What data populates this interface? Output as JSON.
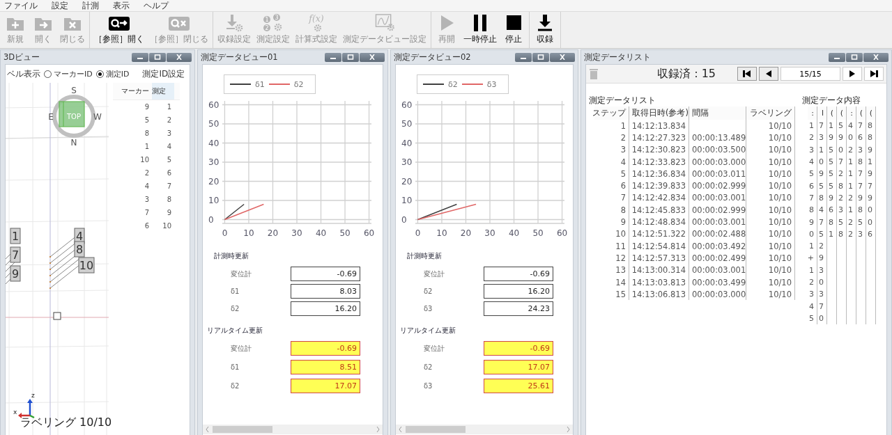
{
  "menu": [
    "ファイル",
    "設定",
    "計測",
    "表示",
    "ヘルプ"
  ],
  "toolbar": {
    "groups": [
      [
        {
          "kind": "new",
          "label": "新規",
          "disabled": true
        },
        {
          "kind": "open",
          "label": "開く",
          "disabled": true
        },
        {
          "kind": "close",
          "label": "閉じる",
          "disabled": true
        }
      ],
      [
        {
          "kind": "ref-open",
          "label": "［参照］開く",
          "disabled": false
        },
        {
          "kind": "ref-close",
          "label": "［参照］閉じる",
          "disabled": true
        }
      ],
      [
        {
          "kind": "record-settings",
          "label": "収録設定",
          "disabled": true
        },
        {
          "kind": "measure-settings",
          "label": "測定設定",
          "disabled": true,
          "glyphs": [
            "1",
            "3",
            "2"
          ]
        },
        {
          "kind": "formula",
          "label": "計算式設定",
          "disabled": true,
          "glyphs": [
            "f(x)"
          ]
        },
        {
          "kind": "view-settings",
          "label": "測定データビュー設定",
          "disabled": true
        }
      ],
      [
        {
          "kind": "resume",
          "label": "再開",
          "disabled": true
        },
        {
          "kind": "pause",
          "label": "一時停止",
          "disabled": false
        },
        {
          "kind": "stop",
          "label": "停止",
          "disabled": false
        }
      ],
      [
        {
          "kind": "record",
          "label": "収録",
          "disabled": false
        }
      ]
    ]
  },
  "view3d": {
    "title": "3Dビュー",
    "label_mode": {
      "label": "ベル表示",
      "options": [
        {
          "label": "マーカーID",
          "selected": false
        },
        {
          "label": "測定ID",
          "selected": true
        }
      ]
    },
    "compass": {
      "top": "S",
      "left": "E",
      "right": "W",
      "bottom": "N",
      "face": "TOP"
    },
    "markers": [
      "1",
      "7",
      "9",
      "4",
      "8",
      "10"
    ],
    "axes": {
      "z": "z",
      "x": "x"
    },
    "status": "ラベリング 10/10",
    "id_table": {
      "title": "測定ID設定",
      "columns": [
        "マーカー",
        "測定"
      ],
      "rows": [
        [
          "9",
          "1"
        ],
        [
          "5",
          "2"
        ],
        [
          "8",
          "3"
        ],
        [
          "1",
          "4"
        ],
        [
          "10",
          "5"
        ],
        [
          "2",
          "6"
        ],
        [
          "4",
          "7"
        ],
        [
          "3",
          "8"
        ],
        [
          "7",
          "9"
        ],
        [
          "6",
          "10"
        ]
      ]
    }
  },
  "views": [
    {
      "title": "測定データビュー01",
      "chart_data": {
        "type": "line",
        "grid": true,
        "xlim": [
          -1,
          61
        ],
        "ylim": [
          -2,
          62
        ],
        "xticks": [
          0,
          10,
          20,
          30,
          40,
          50,
          60
        ],
        "yticks": [
          0,
          10,
          20,
          30,
          40,
          50,
          60
        ],
        "series": [
          {
            "name": "δ1",
            "color": "#404040",
            "x": [
              0,
              8.03
            ],
            "values": [
              0,
              8
            ]
          },
          {
            "name": "δ2",
            "color": "#e06666",
            "x": [
              0,
              16.2
            ],
            "values": [
              0,
              8
            ]
          }
        ]
      },
      "measured": {
        "title": "計測時更新",
        "rows": [
          {
            "label": "変位計",
            "value": "-0.69"
          },
          {
            "label": "δ1",
            "value": "8.03"
          },
          {
            "label": "δ2",
            "value": "16.20"
          }
        ]
      },
      "realtime": {
        "title": "リアルタイム更新",
        "rows": [
          {
            "label": "変位計",
            "value": "-0.69"
          },
          {
            "label": "δ1",
            "value": "8.51"
          },
          {
            "label": "δ2",
            "value": "17.07"
          }
        ]
      }
    },
    {
      "title": "測定データビュー02",
      "chart_data": {
        "type": "line",
        "grid": true,
        "xlim": [
          -1,
          61
        ],
        "ylim": [
          -2,
          62
        ],
        "xticks": [
          0,
          10,
          20,
          30,
          40,
          50,
          60
        ],
        "yticks": [
          0,
          10,
          20,
          30,
          40,
          50,
          60
        ],
        "series": [
          {
            "name": "δ2",
            "color": "#404040",
            "x": [
              0,
              16.2
            ],
            "values": [
              0,
              8
            ]
          },
          {
            "name": "δ3",
            "color": "#e06666",
            "x": [
              0,
              24.23
            ],
            "values": [
              0,
              8
            ]
          }
        ]
      },
      "measured": {
        "title": "計測時更新",
        "rows": [
          {
            "label": "変位計",
            "value": "-0.69"
          },
          {
            "label": "δ2",
            "value": "16.20"
          },
          {
            "label": "δ3",
            "value": "24.23"
          }
        ]
      },
      "realtime": {
        "title": "リアルタイム更新",
        "rows": [
          {
            "label": "変位計",
            "value": "-0.69"
          },
          {
            "label": "δ2",
            "value": "17.07"
          },
          {
            "label": "δ3",
            "value": "25.61"
          }
        ]
      }
    }
  ],
  "datalist": {
    "title": "測定データリスト",
    "recorded": "収録済：15",
    "page": "15/15",
    "list": {
      "title": "測定データリスト",
      "columns": [
        "ステップ",
        "取得日時(参考)",
        "間隔",
        "ラベリング"
      ],
      "rows": [
        {
          "step": "1",
          "time": "14:12:13.834",
          "labeling": "10/10"
        },
        [
          "2",
          "14:12:27.323",
          "00:00:13.489",
          "10/10"
        ],
        [
          "3",
          "14:12:30.823",
          "00:00:03.500",
          "10/10"
        ],
        [
          "4",
          "14:12:33.823",
          "00:00:03.000",
          "10/10"
        ],
        [
          "5",
          "14:12:36.834",
          "00:00:03.011",
          "10/10"
        ],
        [
          "6",
          "14:12:39.833",
          "00:00:02.999",
          "10/10"
        ],
        [
          "7",
          "14:12:42.834",
          "00:00:03.001",
          "10/10"
        ],
        [
          "8",
          "14:12:45.833",
          "00:00:02.999",
          "10/10"
        ],
        [
          "9",
          "14:12:48.834",
          "00:00:03.001",
          "10/10"
        ],
        [
          "10",
          "14:12:51.322",
          "00:00:02.488",
          "10/10"
        ],
        [
          "11",
          "14:12:54.814",
          "00:00:03.492",
          "10/10"
        ],
        [
          "12",
          "14:12:57.313",
          "00:00:02.499",
          "10/10"
        ],
        [
          "13",
          "14:13:00.314",
          "00:00:03.001",
          "10/10"
        ],
        [
          "14",
          "14:13:03.813",
          "00:00:03.499",
          "10/10"
        ],
        [
          "15",
          "14:13:06.813",
          "00:00:03.000",
          "10/10"
        ]
      ]
    },
    "content": {
      "title": "測定データ内容",
      "columns": [
        ":",
        "l",
        "(",
        "(",
        ":",
        "(",
        "("
      ],
      "rows": [
        [
          "1",
          "7",
          "1",
          "5",
          "4",
          "7",
          "8"
        ],
        [
          "2",
          "3",
          "9",
          "9",
          "0",
          "6",
          "8"
        ],
        [
          "3",
          "1",
          "5",
          "0",
          "2",
          "3",
          "9"
        ],
        [
          "4",
          "0",
          "5",
          "7",
          "1",
          "8",
          "1"
        ],
        [
          "5",
          "9",
          "5",
          "2",
          "1",
          "7",
          "9"
        ],
        [
          "6",
          "5",
          "5",
          "8",
          "1",
          "7",
          "7"
        ],
        [
          "7",
          "8",
          "9",
          "2",
          "2",
          "9",
          "9"
        ],
        [
          "8",
          "4",
          "6",
          "3",
          "1",
          "8",
          "0"
        ],
        [
          "9",
          "7",
          "8",
          "5",
          "2",
          "5",
          "0"
        ],
        [
          "0",
          "5",
          "1",
          "8",
          "2",
          "3",
          "6"
        ],
        [
          "1",
          "2"
        ],
        [
          "+",
          "9"
        ],
        [
          "1",
          "3"
        ],
        [
          "2",
          "0"
        ],
        [
          "3",
          "3"
        ],
        [
          "4",
          "7"
        ],
        [
          "5",
          "0"
        ]
      ]
    }
  }
}
